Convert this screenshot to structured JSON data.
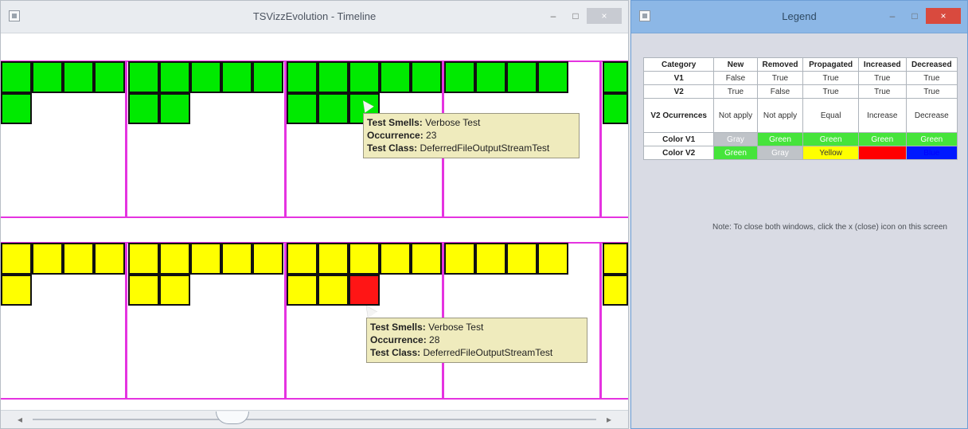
{
  "timeline": {
    "title": "TSVizzEvolution - Timeline",
    "tooltips": [
      {
        "smells_label": "Test Smells:",
        "smells": "Verbose Test",
        "occurrence_label": "Occurrence:",
        "occurrence": "23",
        "class_label": "Test Class:",
        "class": "DeferredFileOutputStreamTest"
      },
      {
        "smells_label": "Test Smells:",
        "smells": "Verbose Test",
        "occurrence_label": "Occurrence:",
        "occurrence": "28",
        "class_label": "Test Class:",
        "class": "DeferredFileOutputStreamTest"
      }
    ]
  },
  "legend": {
    "title": "Legend",
    "headers": [
      "Category",
      "New",
      "Removed",
      "Propagated",
      "Increased",
      "Decreased"
    ],
    "rows": [
      [
        "V1",
        "False",
        "True",
        "True",
        "True",
        "True"
      ],
      [
        "V2",
        "True",
        "False",
        "True",
        "True",
        "True"
      ],
      [
        "V2 Ocurrences",
        "Not apply",
        "Not apply",
        "Equal",
        "Increase",
        "Decrease"
      ],
      [
        "Color V1",
        "Gray",
        "Green",
        "Green",
        "Green",
        "Green"
      ],
      [
        "Color V2",
        "Green",
        "Gray",
        "Yellow",
        "Red",
        "Blue"
      ]
    ],
    "note": "Note: To close both windows, click the x (close) icon on this screen"
  },
  "window_controls": {
    "minimize": "–",
    "maximize": "□",
    "close": "×"
  },
  "colors": {
    "accent_magenta": "#e533e0",
    "cell_green": "#00ea00",
    "cell_yellow": "#ffff00",
    "cell_red": "#ff1515",
    "legend_blue": "#0019ff"
  }
}
